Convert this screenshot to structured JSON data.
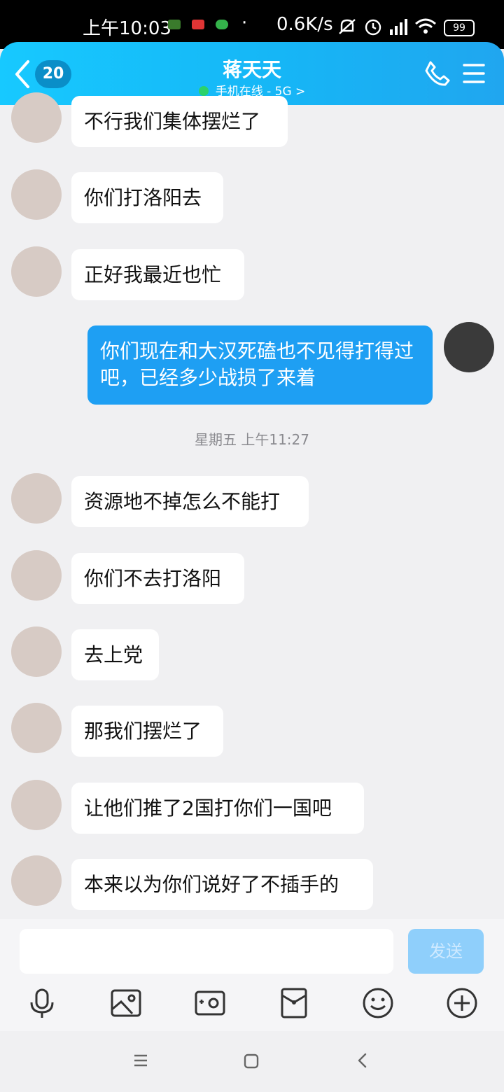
{
  "status_bar": {
    "time": "上午10:03",
    "net_speed": "0.6K/s",
    "battery": "99"
  },
  "header": {
    "back_badge": "20",
    "title": "蒋天天",
    "subtitle": "手机在线 - 5G",
    "subtitle_arrow": ">",
    "icons": [
      "back-chevron-icon",
      "phone-icon",
      "menu-icon"
    ]
  },
  "messages": [
    {
      "side": "in",
      "text": "不行我们集体摆烂了"
    },
    {
      "side": "in",
      "text": "你们打洛阳去"
    },
    {
      "side": "in",
      "text": "正好我最近也忙"
    },
    {
      "side": "out",
      "text": "你们现在和大汉死磕也不见得打得过吧，已经多少战损了来着"
    },
    {
      "side": "in",
      "text": "资源地不掉怎么不能打"
    },
    {
      "side": "in",
      "text": "你们不去打洛阳"
    },
    {
      "side": "in",
      "text": "去上党"
    },
    {
      "side": "in",
      "text": "那我们摆烂了"
    },
    {
      "side": "in",
      "text": "让他们推了2国打你们一国吧"
    },
    {
      "side": "in",
      "text": "本来以为你们说好了不插手的"
    }
  ],
  "timestamp": "星期五 上午11:27",
  "input": {
    "value": "",
    "send_label": "发送"
  },
  "toolbar": {
    "icons": [
      "microphone-icon",
      "photo-icon",
      "camera-icon",
      "red-packet-icon",
      "emoji-icon",
      "plus-icon"
    ]
  },
  "nav": {
    "icons": [
      "recents-icon",
      "home-icon",
      "back-icon"
    ]
  },
  "colors": {
    "header_start": "#17c9ff",
    "header_end": "#20a6ef",
    "out_bubble": "#1e9ff3",
    "in_bubble": "#ffffff",
    "background": "#f0f0f2"
  }
}
